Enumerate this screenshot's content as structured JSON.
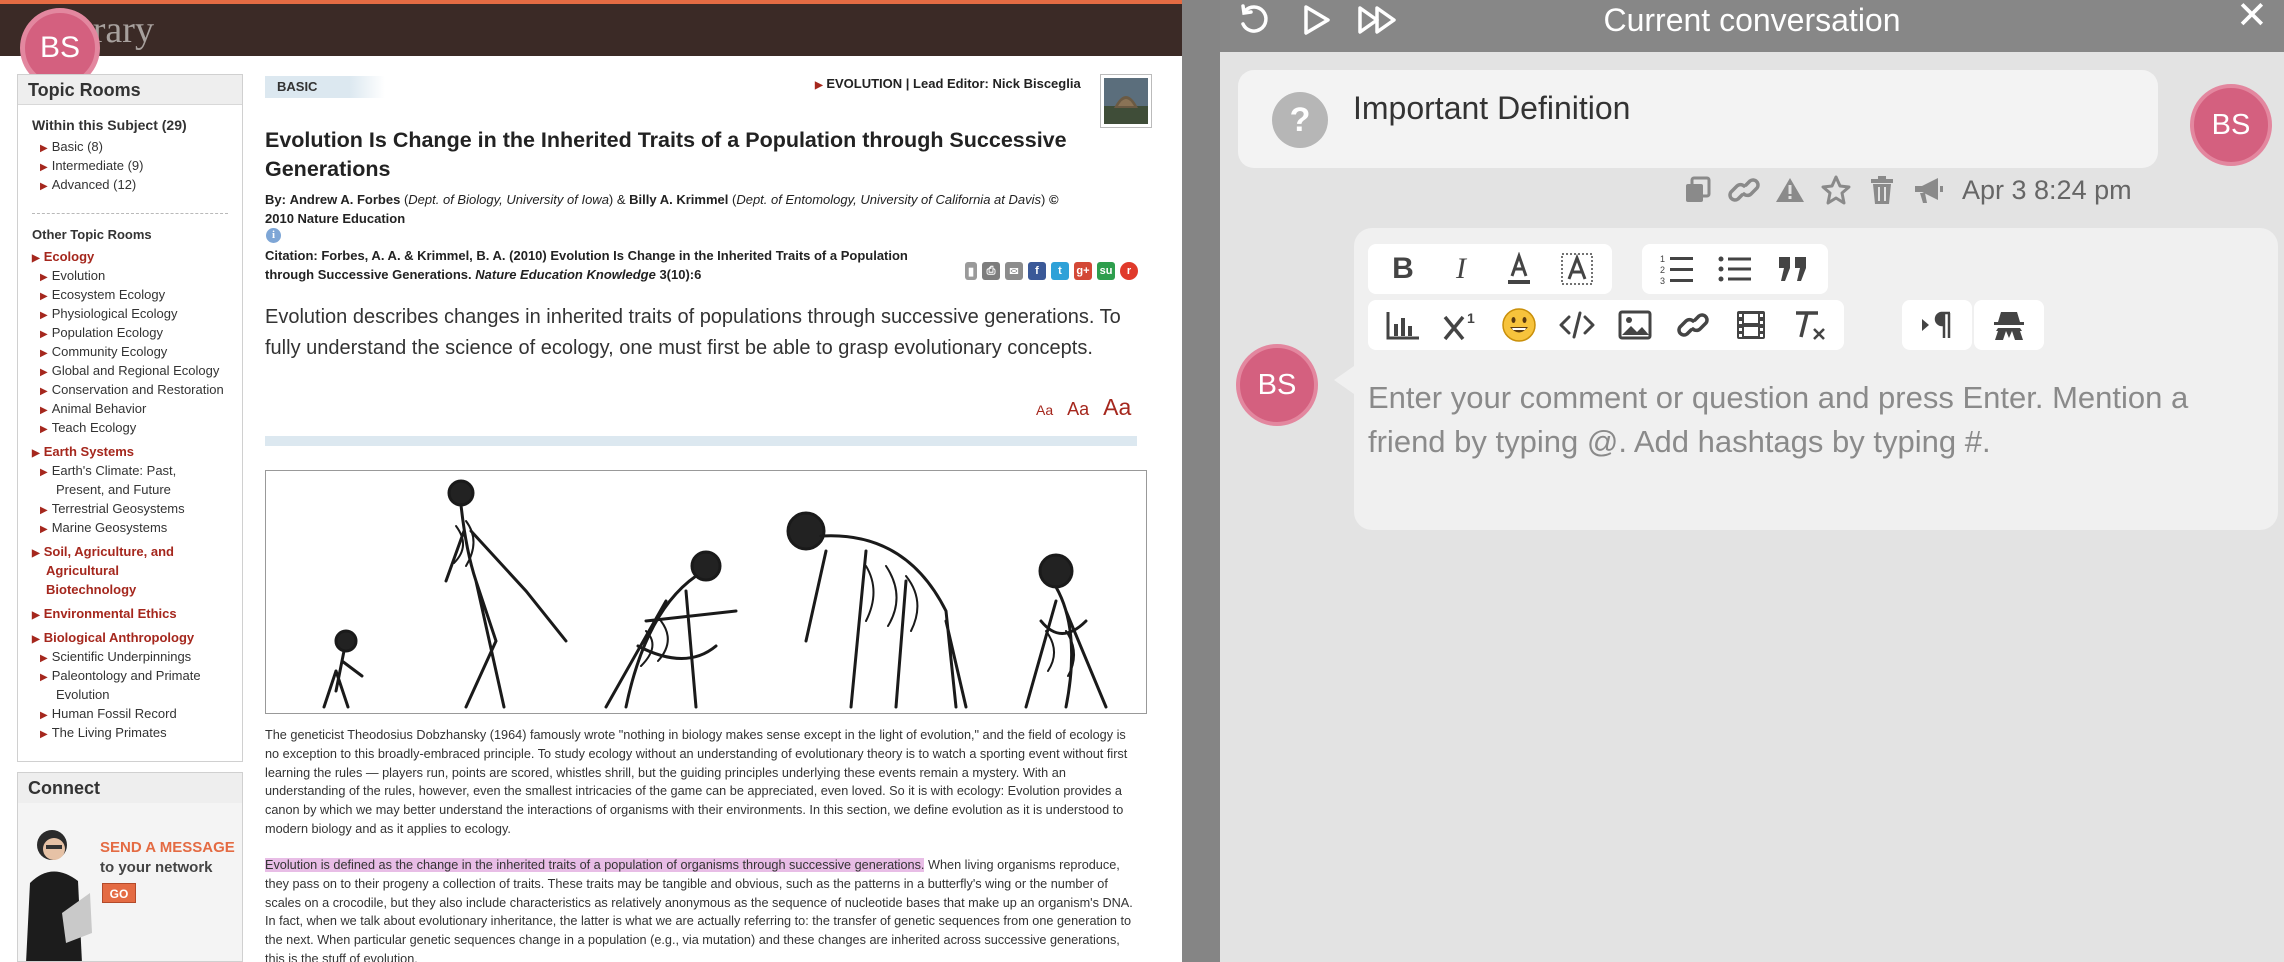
{
  "article": {
    "library_logo": "Library",
    "user_initials": "BS",
    "sidebar": {
      "title": "Topic Rooms",
      "within_subject": "Within this Subject (29)",
      "levels": [
        "Basic (8)",
        "Intermediate (9)",
        "Advanced (12)"
      ],
      "other_rooms": "Other Topic Rooms",
      "categories": [
        {
          "name": "Ecology",
          "items": [
            "Evolution",
            "Ecosystem Ecology",
            "Physiological Ecology",
            "Population Ecology",
            "Community Ecology",
            "Global and Regional Ecology",
            "Conservation and Restoration",
            "Animal Behavior",
            "Teach Ecology"
          ]
        },
        {
          "name": "Earth Systems",
          "items": [
            "Earth's Climate: Past,",
            "Present, and Future",
            "Terrestrial Geosystems",
            "Marine Geosystems"
          ]
        },
        {
          "name": "Soil, Agriculture, and",
          "name2": "Agricultural",
          "name3": "Biotechnology",
          "items": []
        },
        {
          "name": "Environmental Ethics",
          "items": []
        },
        {
          "name": "Biological Anthropology",
          "items": [
            "Scientific Underpinnings",
            "Paleontology and Primate",
            "Evolution",
            "Human Fossil Record",
            "The Living Primates"
          ]
        }
      ]
    },
    "connect": {
      "title": "Connect",
      "ad_line1": "SEND A MESSAGE",
      "ad_line2": "to your network",
      "ad_button": "GO"
    },
    "level_tab": "BASIC",
    "breadcrumb": "EVOLUTION",
    "lead_editor_label": "Lead Editor:",
    "lead_editor": "Nick Bisceglia",
    "title": "Evolution Is Change in the Inherited Traits of a Population through Successive Generations",
    "byline_by": "By:",
    "author1": "Andrew A. Forbes",
    "dept1": "Dept. of Biology, University of Iowa",
    "author2": "Billy A. Krimmel",
    "dept2": "Dept. of Entomology, University of California at Davis",
    "copyright": "© 2010 Nature Education",
    "citation_label": "Citation:",
    "citation_text": "Forbes, A. A. & Krimmel, B. A. (2010) Evolution Is Change in the Inherited Traits of a Population through Successive Generations.",
    "citation_journal": "Nature Education Knowledge",
    "citation_vol": "3(10):6",
    "lead": "Evolution describes changes in inherited traits of populations through successive generations. To fully understand the science of ecology, one must first be able to grasp evolutionary concepts.",
    "font_sizes": [
      "Aa",
      "Aa",
      "Aa"
    ],
    "para1": "The geneticist Theodosius Dobzhansky (1964) famously wrote \"nothing in biology makes sense except in the light of evolution,\" and the field of ecology is no exception to this broadly-embraced principle. To study ecology without an understanding of evolutionary theory is to watch a sporting event without first learning the rules — players run, points are scored, whistles shrill, but the guiding principles underlying these events remain a mystery. With an understanding of the rules, however, even the smallest intricacies of the game can be appreciated, even loved. So it is with ecology: Evolution provides a canon by which we may better understand the interactions of organisms with their environments. In this section, we define evolution as it is understood to modern biology and as it applies to ecology.",
    "para2_highlight": "Evolution is defined as the change in the inherited traits of a population of organisms through successive generations.",
    "para2_rest": " When living organisms reproduce, they pass on to their progeny a collection of traits. These traits may be tangible and obvious, such as the patterns in a butterfly's wing or the number of scales on a crocodile, but they also include characteristics as relatively anonymous as the sequence of nucleotide bases that make up an organism's DNA. In fact, when we talk about evolutionary inheritance, the latter is what we are actually referring to: the transfer of genetic sequences from one generation to the next. When particular genetic sequences change in a population (e.g., via mutation) and these changes are inherited across successive generations, this is the stuff of evolution."
  },
  "panel": {
    "title": "Current conversation",
    "close": "✕",
    "topic_icon": "?",
    "topic_title": "Important Definition",
    "user_initials": "BS",
    "date": "Apr 3 8:24 pm",
    "placeholder": "Enter your comment or question and press Enter. Mention a friend by typing @. Add hashtags by typing #.",
    "colors": {
      "avatar": "#d4607f",
      "panel": "#e3e3e3",
      "bar": "#878787"
    }
  }
}
